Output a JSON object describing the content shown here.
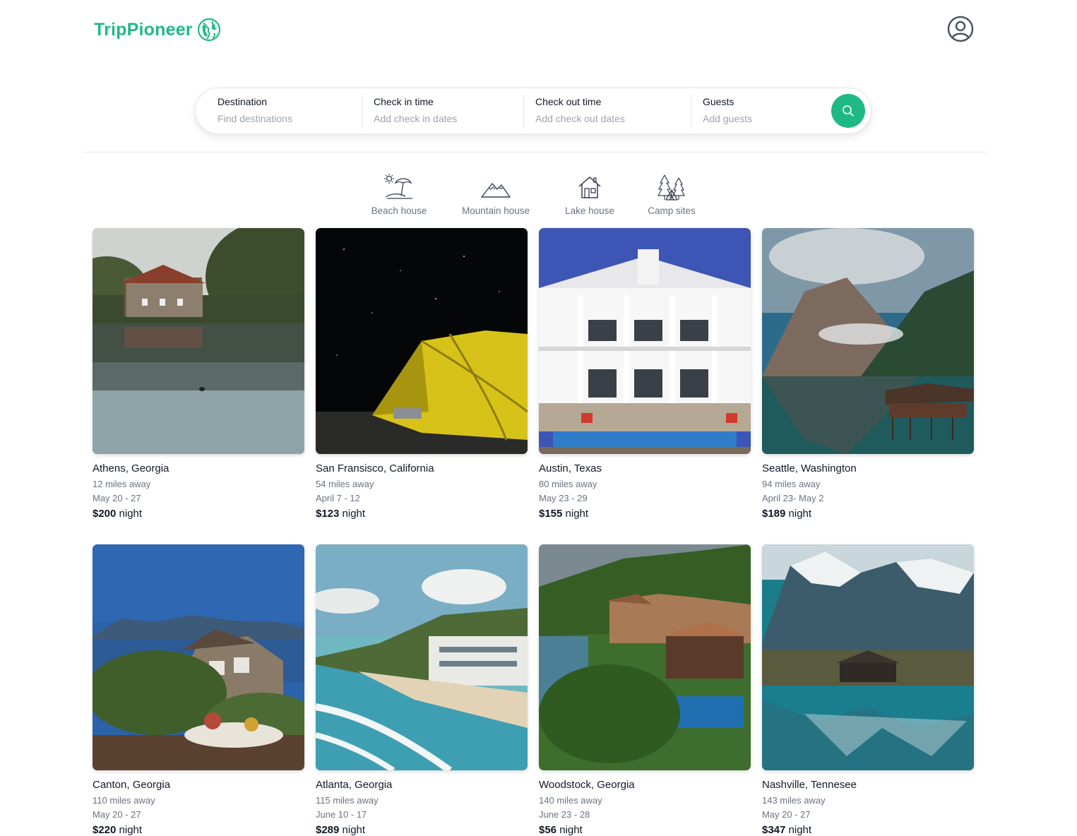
{
  "brand": {
    "name": "TripPioneer",
    "color": "#20b986"
  },
  "header": {
    "profile_icon": "user-circle-icon"
  },
  "search": {
    "fields": [
      {
        "label": "Destination",
        "placeholder": "Find destinations"
      },
      {
        "label": "Check in time",
        "placeholder": "Add check in dates"
      },
      {
        "label": "Check out time",
        "placeholder": "Add check out dates"
      },
      {
        "label": "Guests",
        "placeholder": "Add guests"
      }
    ],
    "button_icon": "search-icon",
    "button_color": "#1fb986"
  },
  "categories": [
    {
      "label": "Beach house",
      "icon": "beach-umbrella-icon"
    },
    {
      "label": "Mountain house",
      "icon": "mountain-icon"
    },
    {
      "label": "Lake house",
      "icon": "house-icon"
    },
    {
      "label": "Camp sites",
      "icon": "camp-tent-icon"
    }
  ],
  "listings": [
    {
      "title": "Athens, Georgia",
      "distance": "12 miles away",
      "dates": "May 20 - 27",
      "price": "$200",
      "per": " night"
    },
    {
      "title": "San Fransisco, California",
      "distance": "54 miles away",
      "dates": "April 7 - 12",
      "price": "$123",
      "per": " night"
    },
    {
      "title": "Austin, Texas",
      "distance": "80 miles away",
      "dates": "May 23 - 29",
      "price": "$155",
      "per": " night"
    },
    {
      "title": "Seattle, Washington",
      "distance": "94 miles away",
      "dates": "April 23- May 2",
      "price": "$189",
      "per": " night"
    },
    {
      "title": "Canton, Georgia",
      "distance": "110 miles away",
      "dates": "May 20 - 27",
      "price": "$220",
      "per": " night"
    },
    {
      "title": "Atlanta, Georgia",
      "distance": "115 miles away",
      "dates": "June 10 - 17",
      "price": "$289",
      "per": " night"
    },
    {
      "title": "Woodstock, Georgia",
      "distance": "140 miles away",
      "dates": "June 23 - 28",
      "price": "$56",
      "per": " night"
    },
    {
      "title": "Nashville, Tennesee",
      "distance": "143 miles away",
      "dates": "May 20 - 27",
      "price": "$347",
      "per": " night"
    }
  ]
}
